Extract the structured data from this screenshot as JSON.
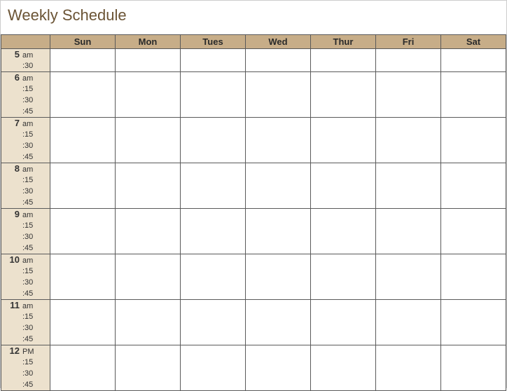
{
  "title": "Weekly Schedule",
  "days": [
    "Sun",
    "Mon",
    "Tues",
    "Wed",
    "Thur",
    "Fri",
    "Sat"
  ],
  "hours": [
    {
      "hour": "5",
      "ampm": "am",
      "subs": [
        ":30"
      ]
    },
    {
      "hour": "6",
      "ampm": "am",
      "subs": [
        ":15",
        ":30",
        ":45"
      ]
    },
    {
      "hour": "7",
      "ampm": "am",
      "subs": [
        ":15",
        ":30",
        ":45"
      ]
    },
    {
      "hour": "8",
      "ampm": "am",
      "subs": [
        ":15",
        ":30",
        ":45"
      ]
    },
    {
      "hour": "9",
      "ampm": "am",
      "subs": [
        ":15",
        ":30",
        ":45"
      ]
    },
    {
      "hour": "10",
      "ampm": "am",
      "subs": [
        ":15",
        ":30",
        ":45"
      ]
    },
    {
      "hour": "11",
      "ampm": "am",
      "subs": [
        ":15",
        ":30",
        ":45"
      ]
    },
    {
      "hour": "12",
      "ampm": "PM",
      "subs": [
        ":15",
        ":30",
        ":45"
      ]
    }
  ]
}
